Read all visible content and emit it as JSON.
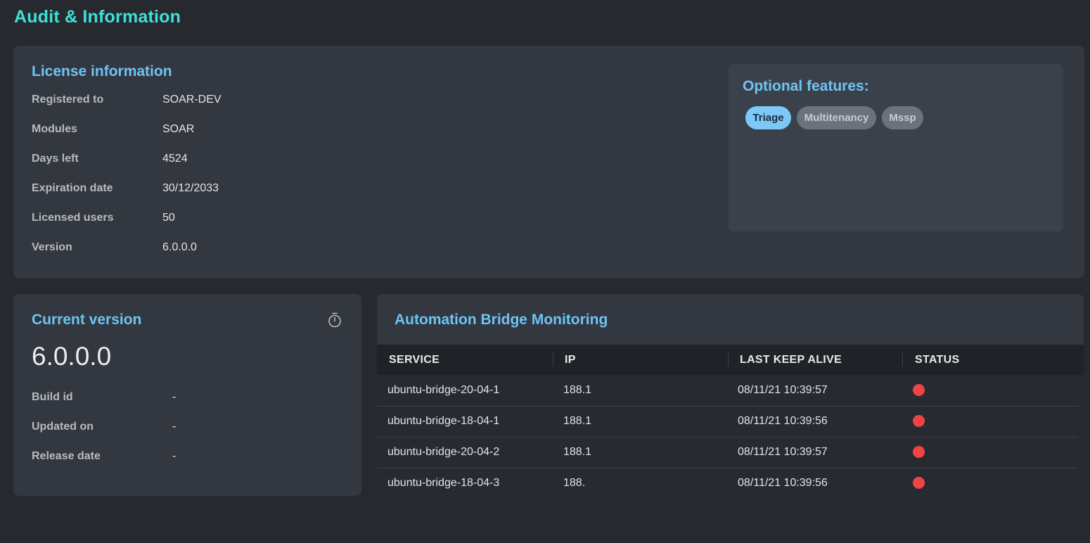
{
  "page": {
    "title": "Audit & Information"
  },
  "license": {
    "title": "License information",
    "rows": [
      {
        "label": "Registered to",
        "value": "SOAR-DEV"
      },
      {
        "label": "Modules",
        "value": "SOAR"
      },
      {
        "label": "Days left",
        "value": "4524"
      },
      {
        "label": "Expiration date",
        "value": "30/12/2033"
      },
      {
        "label": "Licensed users",
        "value": "50"
      },
      {
        "label": "Version",
        "value": "6.0.0.0"
      }
    ]
  },
  "optional_features": {
    "title": "Optional features:",
    "chips": [
      {
        "label": "Triage",
        "active": true
      },
      {
        "label": "Multitenancy",
        "active": false
      },
      {
        "label": "Mssp",
        "active": false
      }
    ]
  },
  "current_version": {
    "title": "Current version",
    "version": "6.0.0.0",
    "icon": "stopwatch-icon",
    "rows": [
      {
        "label": "Build id",
        "value": "-"
      },
      {
        "label": "Updated on",
        "value": "-"
      },
      {
        "label": "Release date",
        "value": "-"
      }
    ]
  },
  "bridge": {
    "title": "Automation Bridge Monitoring",
    "columns": [
      "SERVICE",
      "IP",
      "LAST KEEP ALIVE",
      "STATUS"
    ],
    "rows": [
      {
        "service": "ubuntu-bridge-20-04-1",
        "ip": "188.1",
        "last_keep_alive": "08/11/21 10:39:57",
        "status": "offline"
      },
      {
        "service": "ubuntu-bridge-18-04-1",
        "ip": "188.1",
        "last_keep_alive": "08/11/21 10:39:56",
        "status": "offline"
      },
      {
        "service": "ubuntu-bridge-20-04-2",
        "ip": "188.1",
        "last_keep_alive": "08/11/21 10:39:57",
        "status": "offline"
      },
      {
        "service": "ubuntu-bridge-18-04-3",
        "ip": "188.",
        "last_keep_alive": "08/11/21 10:39:56",
        "status": "offline"
      }
    ]
  },
  "colors": {
    "page_title": "#3ee0d8",
    "section_title": "#6ec4f5",
    "status_offline": "#f04444",
    "chip_active": "#7cc9f8",
    "chip_inactive": "#6b727d"
  }
}
